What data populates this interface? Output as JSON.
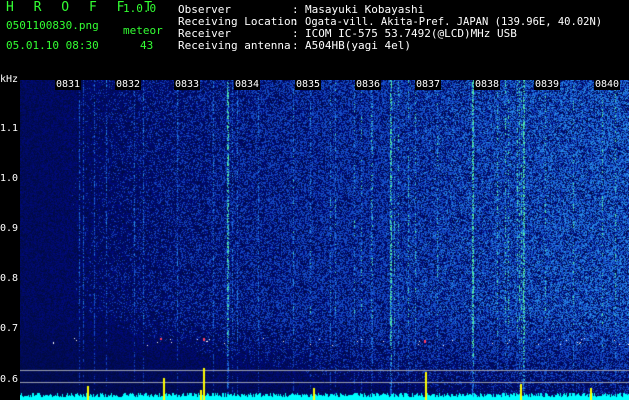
{
  "app": {
    "name": "H R O F F T",
    "version": "1.0.0"
  },
  "file": {
    "name": "0501100830.png",
    "datetime": "05.01.10 08:30"
  },
  "meteor": {
    "label": "meteor",
    "count": "43"
  },
  "info": [
    {
      "key": "Observer",
      "sep": ":",
      "value": "Masayuki Kobayashi"
    },
    {
      "key": "Receiving Location",
      "sep": ":",
      "value": "Ogata-vill. Akita-Pref. JAPAN (139.96E, 40.02N)"
    },
    {
      "key": "Receiver",
      "sep": ":",
      "value": "ICOM IC-575 53.7492(@LCD)MHz USB"
    },
    {
      "key": "Receiving antenna",
      "sep": ":",
      "value": "A504HB(yagi 4el)"
    }
  ],
  "axis": {
    "unit": "kHz",
    "ticks": [
      "1.1",
      "1.0",
      "0.9",
      "0.8",
      "0.7",
      "0.6"
    ]
  },
  "time_labels": [
    "0831",
    "0832",
    "0833",
    "0834",
    "0835",
    "0836",
    "0837",
    "0838",
    "0839",
    "0840"
  ],
  "colors": {
    "header_text": "#33ff33",
    "info_text": "#ffffff",
    "background_noise": "#0a1a8c",
    "echo": "#44ff88",
    "baseline": "#00ffff",
    "spike": "#ffff00"
  }
}
